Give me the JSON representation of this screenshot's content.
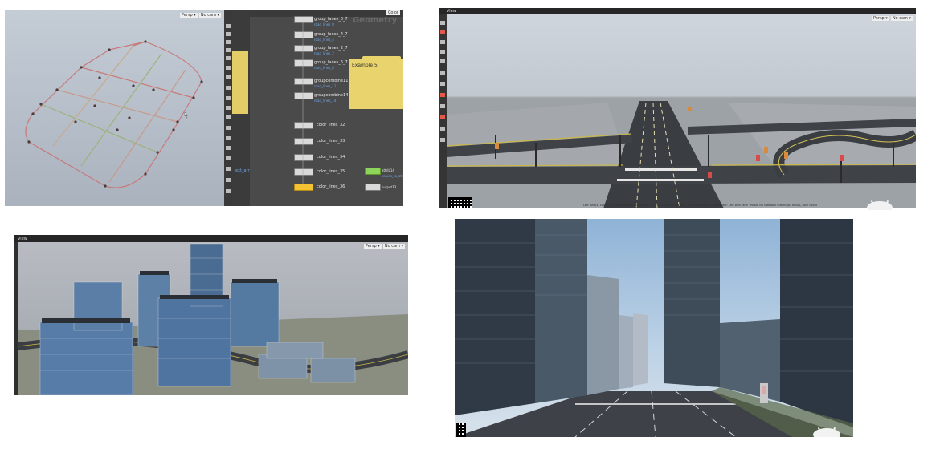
{
  "panel1": {
    "network_title": "Geometry",
    "network_pane_button": "Color",
    "viewport_buttons": [
      "Persp ▾",
      "No cam ▾"
    ],
    "nodes": [
      {
        "name": "group_lanes_0_7",
        "sub": "road_lines_0"
      },
      {
        "name": "group_lanes_4_7",
        "sub": "road_lines_4"
      },
      {
        "name": "group_lanes_2_7",
        "sub": "road_lines_2"
      },
      {
        "name": "group_lanes_6_7",
        "sub": "road_lines_6"
      },
      {
        "name": "groupcombine11",
        "sub": "road_lines_11"
      },
      {
        "name": "groupcombine14",
        "sub": "road_lines_14"
      },
      {
        "name": "color_lines_32",
        "sub": ""
      },
      {
        "name": "color_lines_33",
        "sub": ""
      },
      {
        "name": "color_lines_34",
        "sub": ""
      },
      {
        "name": "color_lines_35",
        "sub": ""
      },
      {
        "name": "color_lines_36",
        "sub": ""
      }
    ],
    "side_nodes": [
      {
        "name": "attribwrangle",
        "sub": "attrib14",
        "sub2": "values_to_attr"
      },
      {
        "name": "output",
        "sub": "output13",
        "sub2": ""
      }
    ],
    "sticky_note_label": "Example 5",
    "left_column_label": "ext_arr"
  },
  "panel2": {
    "pane_title": "View",
    "viewport_buttons": [
      "Persp ▾",
      "No cam ▾"
    ],
    "status_text": "Left lane(s) count 3 · Middle lanes: Right lanes · On left Left lane options · On Right counts · Separator: Left with lane · Road: No sidewalk markings, dashy, pole count"
  },
  "panel3": {
    "pane_title": "View",
    "viewport_buttons": [
      "Persp ▾",
      "No cam ▾"
    ]
  },
  "panel4": {},
  "colors": {
    "houdini_bg": "#2d2d2d",
    "node_network_bg": "#4a4a4a",
    "sticky_note": "#e9d36c",
    "viewport_sky": "#c4ccd6",
    "road_asphalt": "#3a3d42",
    "lane_marking": "#e8e0b0"
  }
}
